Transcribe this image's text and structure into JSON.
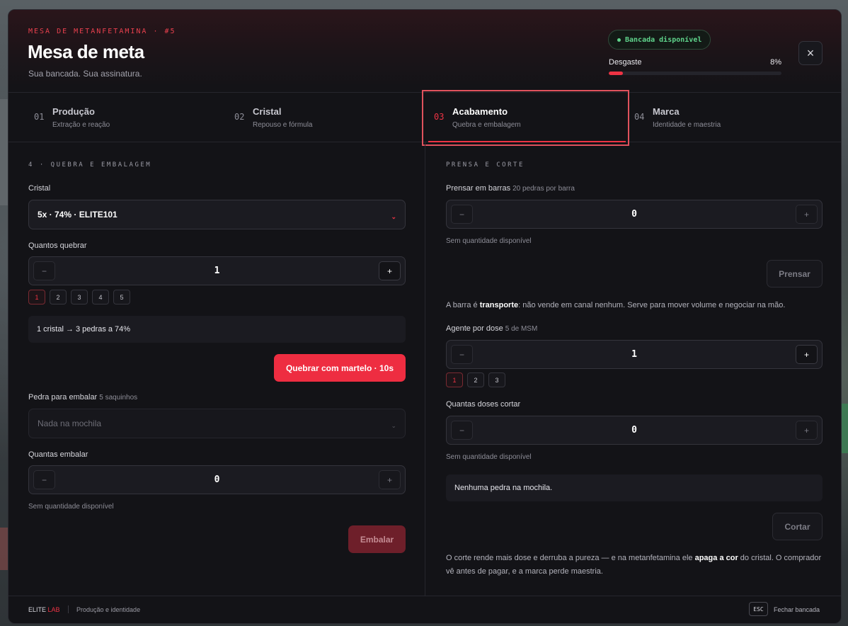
{
  "header": {
    "eyebrow": "MESA DE METANFETAMINA · #5",
    "title": "Mesa de meta",
    "subtitle": "Sua bancada. Sua assinatura.",
    "status": "Bancada disponível",
    "wear_label": "Desgaste",
    "wear_value": "8%",
    "wear_fraction": 0.08,
    "close_icon": "×"
  },
  "steps": [
    {
      "num": "01",
      "label": "Produção",
      "desc": "Extração e reação"
    },
    {
      "num": "02",
      "label": "Cristal",
      "desc": "Repouso e fórmula"
    },
    {
      "num": "03",
      "label": "Acabamento",
      "desc": "Quebra e embalagem"
    },
    {
      "num": "04",
      "label": "Marca",
      "desc": "Identidade e maestria"
    }
  ],
  "left": {
    "section_title": "4 · QUEBRA E EMBALAGEM",
    "crystal_label": "Cristal",
    "crystal_value": "5x · 74% · ELITE101",
    "break_label": "Quantos quebrar",
    "break_qty": "1",
    "break_chips": [
      "1",
      "2",
      "3",
      "4",
      "5"
    ],
    "break_info": "1 cristal → 3 pedras a 74%",
    "break_button": "Quebrar com martelo · 10s",
    "pack_stone_label": "Pedra para embalar",
    "pack_stone_hint": "5 saquinhos",
    "pack_stone_value": "Nada na mochila",
    "pack_qty_label": "Quantas embalar",
    "pack_qty": "0",
    "pack_note": "Sem quantidade disponível",
    "pack_button": "Embalar"
  },
  "right": {
    "section_title": "PRENSA E CORTE",
    "press_label": "Prensar em barras",
    "press_hint": "20 pedras por barra",
    "press_qty": "0",
    "press_note": "Sem quantidade disponível",
    "press_button": "Prensar",
    "bar_text_1": "A barra é",
    "bar_text_bold": "transporte",
    "bar_text_2": ": não vende em canal nenhum. Serve para mover volume e negociar na mão.",
    "agent_label": "Agente por dose",
    "agent_hint": "5 de MSM",
    "agent_qty": "1",
    "agent_chips": [
      "1",
      "2",
      "3"
    ],
    "cut_label": "Quantas doses cortar",
    "cut_qty": "0",
    "cut_note": "Sem quantidade disponível",
    "cut_info": "Nenhuma pedra na mochila.",
    "cut_button": "Cortar",
    "cut_text_1": "O corte rende mais dose e derruba a pureza — e na metanfetamina ele",
    "cut_text_bold": "apaga a cor",
    "cut_text_2": "do cristal. O comprador vê antes de pagar, e a marca perde maestria."
  },
  "footer": {
    "brand_main": "ELITE",
    "brand_accent": "LAB",
    "tagline": "Produção e identidade",
    "esc_key": "ESC",
    "close_hint": "Fechar bancada"
  },
  "colors": {
    "accent": "#ee3344",
    "success": "#5fd38b",
    "background": "#131317"
  }
}
